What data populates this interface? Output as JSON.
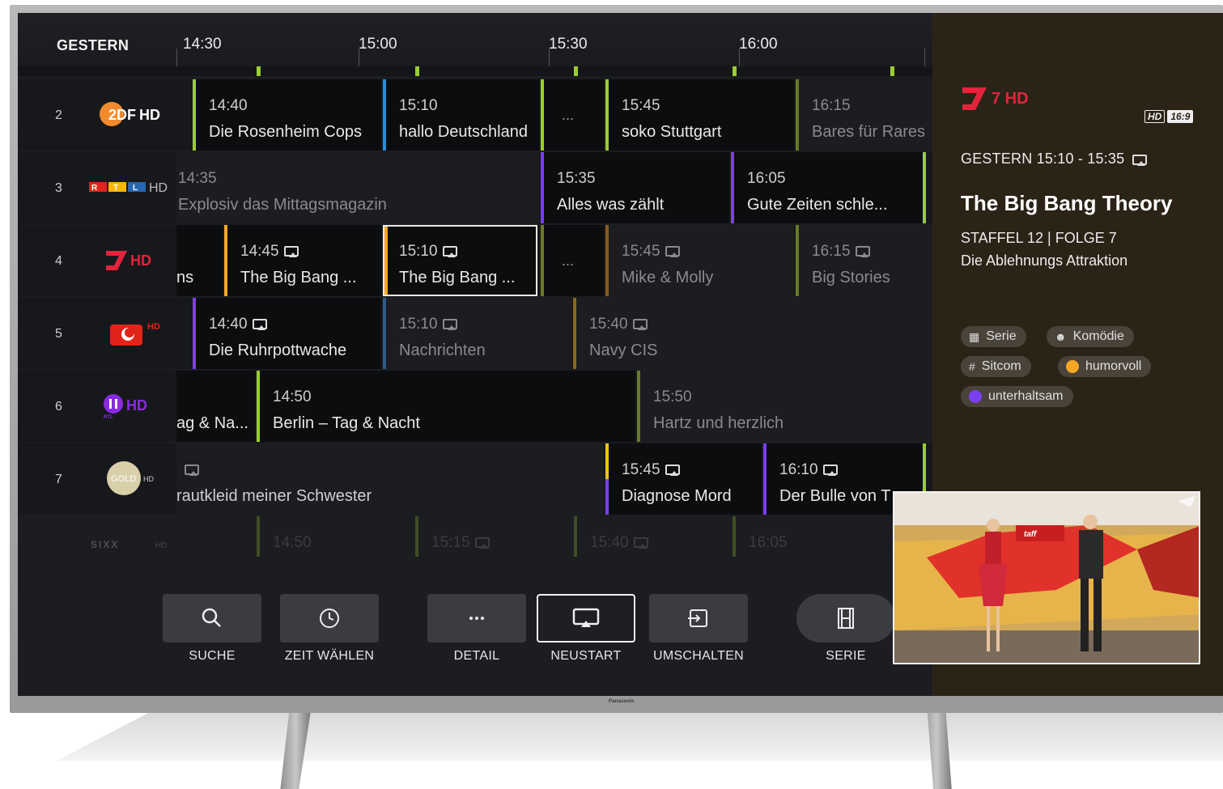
{
  "tv": {
    "brand": "Panasonic"
  },
  "timeline": {
    "day": "GESTERN",
    "times": [
      "14:30",
      "15:00",
      "15:30",
      "16:00"
    ]
  },
  "rows": [
    {
      "num": "2",
      "channel": "ZDF HD",
      "programs": [
        {
          "time": "14:40",
          "title": "Die Rosenheim Cops"
        },
        {
          "time": "15:10",
          "title": "hallo Deutschland"
        },
        {
          "dots": "..."
        },
        {
          "time": "15:45",
          "title": "soko Stuttgart"
        },
        {
          "time": "16:15",
          "title": "Bares für Rares"
        }
      ]
    },
    {
      "num": "3",
      "channel": "RTL HD",
      "programs": [
        {
          "time": "14:35",
          "title": "Explosiv das Mittagsmagazin"
        },
        {
          "time": "15:35",
          "title": "Alles was zählt"
        },
        {
          "time": "16:05",
          "title": "Gute Zeiten schle..."
        }
      ]
    },
    {
      "num": "4",
      "channel": "ProSieben HD",
      "programs": [
        {
          "title": "ns"
        },
        {
          "time": "14:45",
          "title": "The Big Bang ..."
        },
        {
          "time": "15:10",
          "title": "The Big Bang ..."
        },
        {
          "dots": "..."
        },
        {
          "time": "15:45",
          "title": "Mike & Molly"
        },
        {
          "time": "16:15",
          "title": "Big Stories"
        }
      ]
    },
    {
      "num": "5",
      "channel": "kabel eins HD",
      "programs": [
        {
          "time": "14:40",
          "title": "Die Ruhrpottwache"
        },
        {
          "time": "15:10",
          "title": "Nachrichten"
        },
        {
          "time": "15:40",
          "title": "Navy CIS"
        }
      ]
    },
    {
      "num": "6",
      "channel": "RTL II HD",
      "programs": [
        {
          "title": "ag & Na..."
        },
        {
          "time": "14:50",
          "title": "Berlin – Tag & Nacht"
        },
        {
          "time": "15:50",
          "title": "Hartz und herzlich"
        }
      ]
    },
    {
      "num": "7",
      "channel": "GOLD HD",
      "programs": [
        {
          "title": "rautkleid meiner Schwester"
        },
        {
          "time": "15:45",
          "title": "Diagnose Mord"
        },
        {
          "time": "16:10",
          "title": "Der Bulle von T"
        }
      ]
    },
    {
      "num": "8",
      "channel": "SIXX HD",
      "programs": [
        {
          "time": "14:50"
        },
        {
          "time": "15:15"
        },
        {
          "time": "15:40"
        },
        {
          "time": "16:05"
        }
      ]
    }
  ],
  "actions": [
    {
      "label": "SUCHE",
      "icon": "search-icon"
    },
    {
      "label": "ZEIT WÄHLEN",
      "icon": "clock-icon"
    },
    {
      "label": "DETAIL",
      "icon": "more-icon"
    },
    {
      "label": "NEUSTART",
      "icon": "restart-icon"
    },
    {
      "label": "UMSCHALTEN",
      "icon": "switch-icon"
    },
    {
      "label": "SERIE",
      "icon": "film-icon"
    }
  ],
  "info": {
    "channel_logo": "7 HD",
    "badges": [
      "HD",
      "16:9"
    ],
    "when": "GESTERN 15:10 - 15:35",
    "title": "The Big Bang Theory",
    "episode": "STAFFEL 12 | FOLGE 7",
    "episode_title": "Die Ablehnungs Attraktion",
    "tags": [
      {
        "label": "Serie",
        "icon": "film-icon"
      },
      {
        "label": "Komödie",
        "icon": "mask-icon"
      },
      {
        "label": "Sitcom",
        "icon": "hash-icon"
      },
      {
        "label": "humorvoll",
        "color": "#f5a623"
      },
      {
        "label": "unterhaltsam",
        "color": "#7b3ff2"
      }
    ],
    "preview_logo": "taff"
  },
  "colors": {
    "green": "#9acd32",
    "blue": "#2d8bd8",
    "purple": "#7b3ff2",
    "orange": "#f5a623",
    "yellow": "#f2c318",
    "olive": "#6a7a2a"
  }
}
